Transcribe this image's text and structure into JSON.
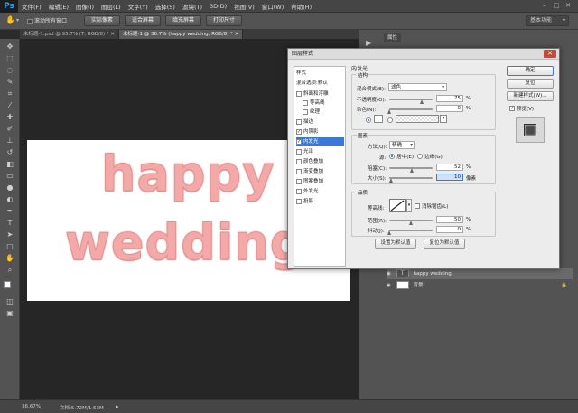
{
  "app": {
    "logo": "Ps"
  },
  "menu": [
    "文件(F)",
    "编辑(E)",
    "图像(I)",
    "图层(L)",
    "文字(Y)",
    "选择(S)",
    "滤镜(T)",
    "3D(D)",
    "视图(V)",
    "窗口(W)",
    "帮助(H)"
  ],
  "options_bar": {
    "scroll_all_windows": "滚动所有窗口",
    "btn_actual_pixels": "实际像素",
    "btn_fit_screen": "适合屏幕",
    "btn_fill_screen": "填充屏幕",
    "btn_print_size": "打印尺寸",
    "workspace": "基本功能"
  },
  "doc_tabs": [
    {
      "label": "未标题-1.psd @ 95.7% (T, RGB/8) *"
    },
    {
      "label": "未标题-1 @ 36.7% (happy wedding, RGB/8) *"
    }
  ],
  "canvas": {
    "line1": "happy",
    "line2": "wedding"
  },
  "status": {
    "zoom": "36.67%",
    "doc_info": "文档:5.72M/1.63M"
  },
  "right_panel": {
    "tab_properties": "属性",
    "layers": [
      {
        "name": "happy wedding"
      },
      {
        "name": "背景"
      }
    ]
  },
  "dialog": {
    "title": "图层样式",
    "close": "✕",
    "styles_header": "样式",
    "blend_options": "混合选项:默认",
    "styles": [
      {
        "label": "斜面和浮雕",
        "checked": false
      },
      {
        "label": "等高线",
        "checked": false
      },
      {
        "label": "纹理",
        "checked": false
      },
      {
        "label": "描边",
        "checked": false
      },
      {
        "label": "内阴影",
        "checked": true
      },
      {
        "label": "内发光",
        "checked": true
      },
      {
        "label": "光泽",
        "checked": false
      },
      {
        "label": "颜色叠加",
        "checked": false
      },
      {
        "label": "渐变叠加",
        "checked": false
      },
      {
        "label": "图案叠加",
        "checked": false
      },
      {
        "label": "外发光",
        "checked": false
      },
      {
        "label": "投影",
        "checked": false
      }
    ],
    "section_title": "内发光",
    "structure": {
      "title": "结构",
      "blend_mode_label": "混合模式(B):",
      "blend_mode_value": "滤色",
      "opacity_label": "不透明度(O):",
      "opacity_value": "75",
      "noise_label": "杂色(N):",
      "noise_value": "0",
      "percent": "%",
      "opacity_pct": 75,
      "noise_pct": 0
    },
    "elements": {
      "title": "图素",
      "method_label": "方法(Q):",
      "method_value": "精确",
      "source_label": "源:",
      "center_label": "居中(E)",
      "edge_label": "边缘(G)",
      "choke_label": "阻塞(C):",
      "choke_value": "52",
      "size_label": "大小(S):",
      "size_value": "10",
      "px": "像素",
      "choke_pct": 52,
      "size_pct": 4
    },
    "quality": {
      "title": "品质",
      "contour_label": "等高线:",
      "antialias_label": "消除锯齿(L)",
      "range_label": "范围(R):",
      "range_value": "50",
      "jitter_label": "抖动(J):",
      "jitter_value": "0",
      "range_pct": 50,
      "jitter_pct": 0
    },
    "btn_set_default": "设置为默认值",
    "btn_reset_default": "复位为默认值",
    "btn_ok": "确定",
    "btn_reset": "复位",
    "btn_new_style": "新建样式(W)...",
    "preview_label": "预览(V)",
    "preview_checked": true
  },
  "colors": {
    "accent": "#3b78d8",
    "text_pink": "#f2a9a7",
    "ps_blue": "#2fa3f5"
  }
}
